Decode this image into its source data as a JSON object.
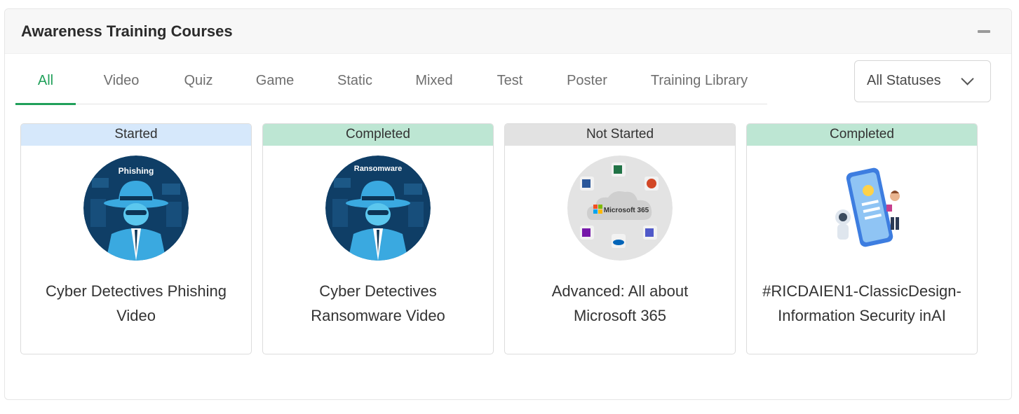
{
  "panel": {
    "title": "Awareness Training Courses"
  },
  "tabs": [
    {
      "label": "All",
      "active": true
    },
    {
      "label": "Video"
    },
    {
      "label": "Quiz"
    },
    {
      "label": "Game"
    },
    {
      "label": "Static"
    },
    {
      "label": "Mixed"
    },
    {
      "label": "Test"
    },
    {
      "label": "Poster"
    },
    {
      "label": "Training Library"
    }
  ],
  "status_filter": {
    "selected": "All Statuses"
  },
  "colors": {
    "accent": "#21a05a",
    "started": "#d6e8fb",
    "completed": "#bde6d3",
    "not_started": "#e2e2e2"
  },
  "cards": [
    {
      "status": "Started",
      "title": "Cyber Detectives Phishing Video",
      "thumb_text": "Phishing",
      "icon": "phishing-detective-icon"
    },
    {
      "status": "Completed",
      "title": "Cyber Detectives Ransomware Video",
      "thumb_text": "Ransomware",
      "icon": "ransomware-detective-icon"
    },
    {
      "status": "Not Started",
      "title": "Advanced: All about Microsoft 365",
      "thumb_text": "Microsoft 365",
      "icon": "microsoft-365-cloud-icon"
    },
    {
      "status": "Completed",
      "title": "#RICDAIEN1-ClassicDesign-Information Security inAI",
      "icon": "ai-phone-illustration-icon"
    }
  ]
}
